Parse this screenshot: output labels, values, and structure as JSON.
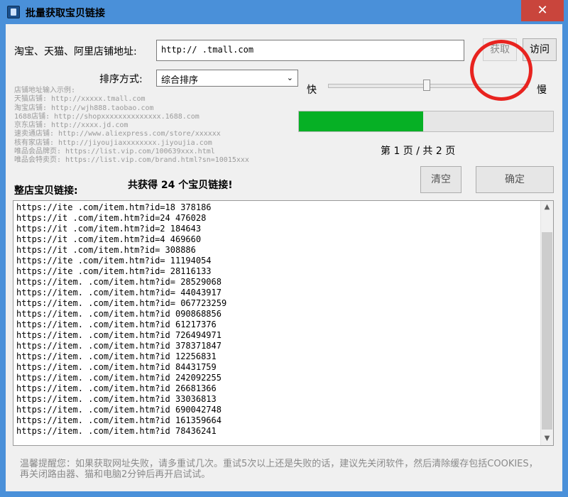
{
  "window": {
    "title": "批量获取宝贝链接",
    "close_glyph": "✕"
  },
  "form": {
    "url_label": "淘宝、天猫、阿里店铺地址:",
    "url_value": "http://        .tmall.com",
    "fetch_label": "获取",
    "visit_label": "访问",
    "sort_label": "排序方式:",
    "sort_value": "综合排序",
    "speed_fast": "快",
    "speed_slow": "慢",
    "speed_level": 0.5
  },
  "examples": [
    "店铺地址输入示例:",
    "天猫店铺: http://xxxxx.tmall.com",
    "淘宝店铺: http://wjh888.taobao.com",
    "1688店铺: http://shopxxxxxxxxxxxxxx.1688.com",
    "京东店铺: http://xxxx.jd.com",
    "速卖通店铺: http://www.aliexpress.com/store/xxxxxx",
    "核有家店铺: http://jiyoujiaxxxxxxxx.jiyoujia.com",
    "唯品会品牌页: https://list.vip.com/100639xxx.html",
    "唯品会特卖页: https://list.vip.com/brand.html?sn=10015xxx"
  ],
  "progress": {
    "fraction": 0.49,
    "page_text": "第 1 页 / 共 2 页"
  },
  "actions": {
    "clear_label": "清空",
    "confirm_label": "确定"
  },
  "results": {
    "label": "整店宝贝链接:",
    "summary": "共获得 24 个宝贝链接!",
    "links": [
      "https://ite        .com/item.htm?id=18   378186",
      "https://it         .com/item.htm?id=24   476028",
      "https://it         .com/item.htm?id=2    184643",
      "https://it         .com/item.htm?id=4    469660",
      "https://it         .com/item.htm?id=     308886",
      "https://ite        .com/item.htm?id=     11194054",
      "https://ite        .com/item.htm?id=     28116133",
      "https://item.      .com/item.htm?id=     28529068",
      "https://item.      .com/item.htm?id=     44043917",
      "https://item.      .com/item.htm?id=     067723259",
      "https://item.      .com/item.htm?id      090868856",
      "https://item.      .com/item.htm?id      61217376",
      "https://item.      .com/item.htm?id      726494971",
      "https://item.      .com/item.htm?id      378371847",
      "https://item.      .com/item.htm?id      12256831",
      "https://item.      .com/item.htm?id      84431759",
      "https://item.      .com/item.htm?id      242092255",
      "https://item.      .com/item.htm?id      26681366",
      "https://item.      .com/item.htm?id      33036813",
      "https://item.      .com/item.htm?id      690042748",
      "https://item.      .com/item.htm?id      161359664",
      "https://item.      .com/item.htm?id      78436241"
    ]
  },
  "hint": "温馨提醒您：如果获取网址失败，请多重试几次。重试5次以上还是失败的话，建议先关闭软件，然后清除缓存包括COOKIES，再关闭路由器、猫和电脑2分钟后再开启试试。",
  "colors": {
    "title_bar": "#4a90d9",
    "close_button": "#c9453c",
    "progress_fill": "#06b025",
    "annotation_circle": "#e8231f"
  }
}
